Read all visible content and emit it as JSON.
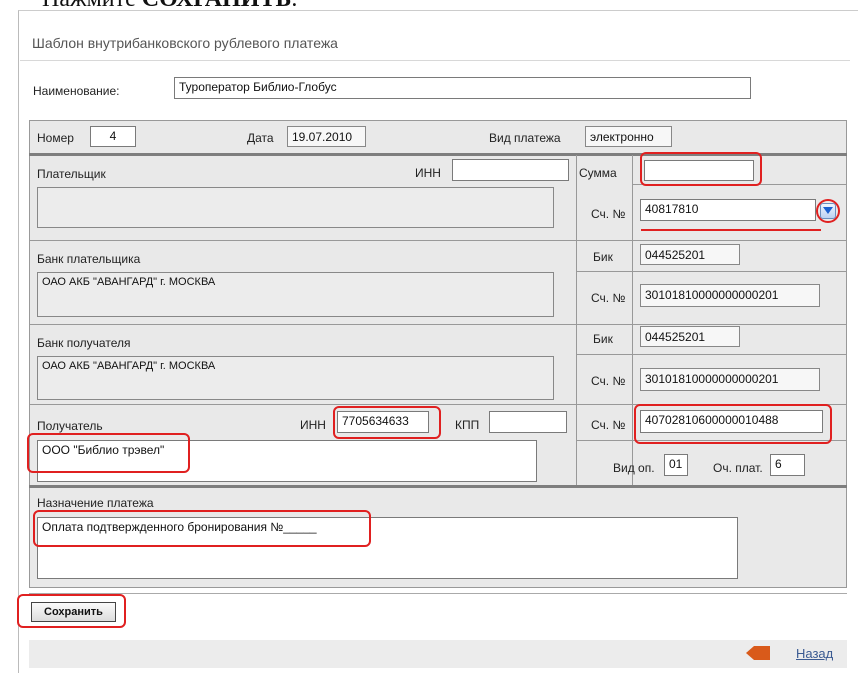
{
  "top_instruction": {
    "prefix": "Нажмите",
    "bold": "СОХРАНИТЬ",
    "suffix": "."
  },
  "form_title": "Шаблон внутрибанковского рублевого платежа",
  "name_field": {
    "label": "Наименование:",
    "value": "Туроператор Библио-Глобус"
  },
  "header_row": {
    "number_label": "Номер",
    "number_value": "4",
    "date_label": "Дата",
    "date_value": "19.07.2010",
    "payment_type_label": "Вид платежа",
    "payment_type_value": "электронно"
  },
  "payer": {
    "label": "Плательщик",
    "inn_label": "ИНН",
    "inn_value": "",
    "sum_label": "Сумма",
    "sum_value": "",
    "account_label": "Сч. №",
    "account_value": "40817810"
  },
  "payer_bank": {
    "label": "Банк плательщика",
    "name": "ОАО АКБ \"АВАНГАРД\" г. МОСКВА",
    "bik_label": "Бик",
    "bik_value": "044525201",
    "account_label": "Сч. №",
    "account_value": "30101810000000000201"
  },
  "recipient_bank": {
    "label": "Банк получателя",
    "name": "ОАО АКБ \"АВАНГАРД\" г. МОСКВА",
    "bik_label": "Бик",
    "bik_value": "044525201",
    "account_label": "Сч. №",
    "account_value": "30101810000000000201"
  },
  "recipient": {
    "label": "Получатель",
    "inn_label": "ИНН",
    "inn_value": "7705634633",
    "kpp_label": "КПП",
    "kpp_value": "",
    "name_value": "ООО \"Библио трэвел\"",
    "account_label": "Сч. №",
    "account_value": "40702810600000010488",
    "op_type_label": "Вид оп.",
    "op_type_value": "01",
    "priority_label": "Оч. плат.",
    "priority_value": "6"
  },
  "purpose": {
    "label": "Назначение платежа",
    "value": "Оплата подтвержденного бронирования №_____"
  },
  "buttons": {
    "save_label": "Сохранить",
    "back_label": "Назад"
  },
  "colors": {
    "highlight": "#e02020",
    "panel_bg": "#e9e9e9",
    "back_arrow": "#d95a1a",
    "link": "#3a5a92"
  }
}
